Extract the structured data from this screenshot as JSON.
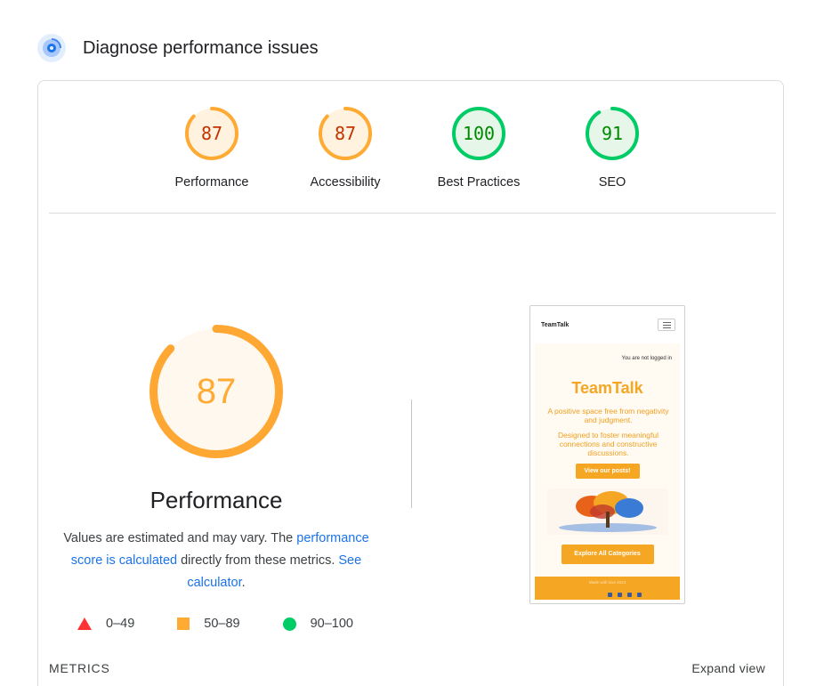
{
  "header": {
    "title": "Diagnose performance issues"
  },
  "categories": [
    {
      "label": "Performance",
      "score": "87",
      "value": 0.87,
      "color": "#fa3",
      "text_color": "#c33300",
      "fill": "#fff3e0"
    },
    {
      "label": "Accessibility",
      "score": "87",
      "value": 0.87,
      "color": "#fa3",
      "text_color": "#c33300",
      "fill": "#fff3e0"
    },
    {
      "label": "Best Practices",
      "score": "100",
      "value": 1.0,
      "color": "#0c6",
      "text_color": "#008800",
      "fill": "#e6f7ea"
    },
    {
      "label": "SEO",
      "score": "91",
      "value": 0.91,
      "color": "#0c6",
      "text_color": "#008800",
      "fill": "#e6f7ea"
    }
  ],
  "detail": {
    "score": "87",
    "value": 0.87,
    "title": "Performance",
    "desc_part1": "Values are estimated and may vary. The ",
    "desc_link1": "performance score is calculated",
    "desc_part2": " directly from these metrics. ",
    "desc_link2": "See calculator",
    "desc_part3": ".",
    "colors": {
      "arc": "#ffa733",
      "fill": "#fff8ee",
      "text": "#fa3"
    }
  },
  "legend": [
    {
      "shape": "triangle",
      "color": "#f33",
      "range": "0–49"
    },
    {
      "shape": "square",
      "color": "#fa3",
      "range": "50–89"
    },
    {
      "shape": "circle",
      "color": "#0c6",
      "range": "90–100"
    }
  ],
  "screenshot": {
    "logo": "TeamTalk",
    "not_logged_in": "You are not logged in",
    "title": "TeamTalk",
    "tagline": "A positive space free from negativity and judgment.",
    "mission": "Designed to foster meaningful connections and constructive discussions.",
    "button1": "View our posts!",
    "button2": "Explore All Categories",
    "footer_text": "Made with love 2024"
  },
  "metrics": {
    "label": "METRICS",
    "expand": "Expand view"
  }
}
